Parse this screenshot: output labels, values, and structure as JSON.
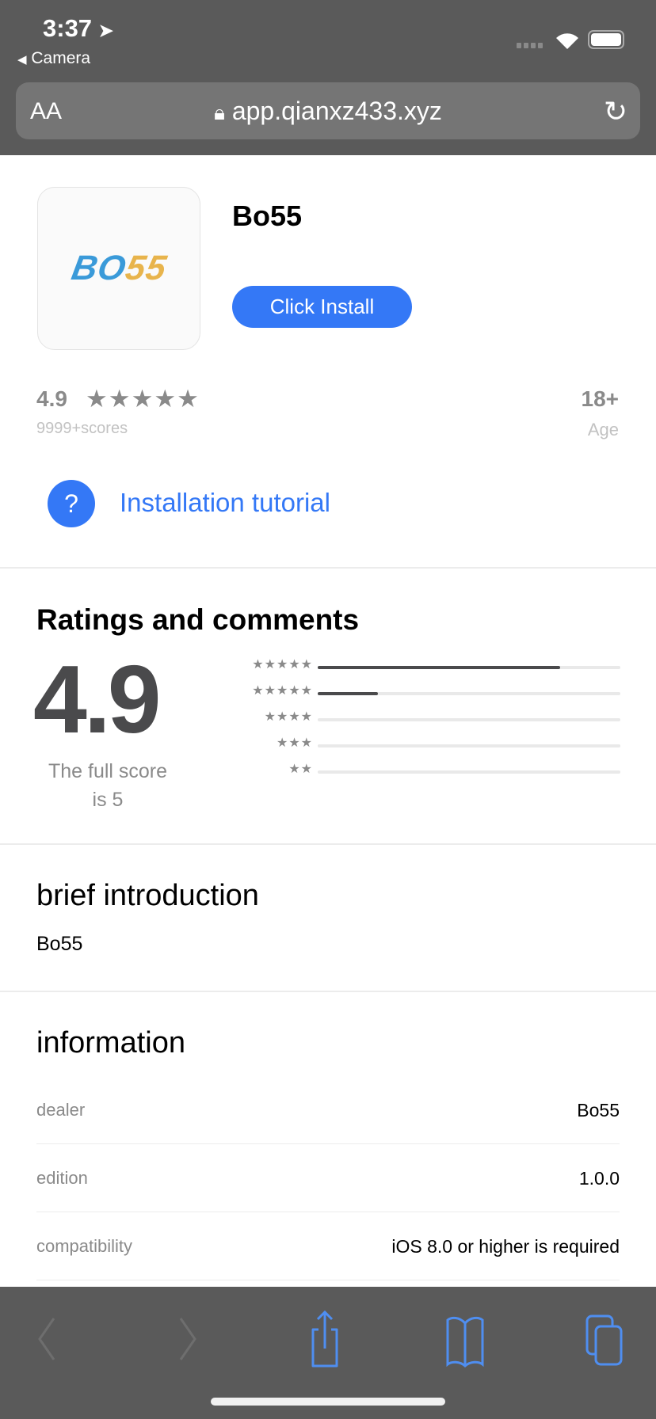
{
  "status_bar": {
    "time": "3:37",
    "back_app": "Camera"
  },
  "browser": {
    "text_size_label": "AA",
    "url": "app.qianxz433.xyz"
  },
  "app": {
    "name": "Bo55",
    "logo_text_blue": "BO",
    "logo_text_gold": "55",
    "install_label": "Click Install",
    "rating": "4.9",
    "stars": "★★★★★",
    "scores": "9999+scores",
    "age": "18+",
    "age_label": "Age",
    "tutorial_label": "Installation tutorial",
    "tutorial_icon": "?"
  },
  "ratings": {
    "title": "Ratings and comments",
    "score": "4.9",
    "full_score_line1": "The full score",
    "full_score_line2": "is 5",
    "rows": [
      {
        "stars": "★★★★★",
        "fraction": 0.8
      },
      {
        "stars": "★★★★★",
        "fraction": 0.2
      },
      {
        "stars": "★★★★",
        "fraction": 0
      },
      {
        "stars": "★★★",
        "fraction": 0
      },
      {
        "stars": "★★",
        "fraction": 0
      }
    ]
  },
  "intro": {
    "title": "brief introduction",
    "text": "Bo55"
  },
  "information": {
    "title": "information",
    "rows": [
      {
        "label": "dealer",
        "value": "Bo55"
      },
      {
        "label": "edition",
        "value": "1.0.0"
      },
      {
        "label": "compatibility",
        "value": "iOS 8.0 or higher is required"
      }
    ]
  },
  "colors": {
    "accent": "#3478f6",
    "chrome": "#5a5a5a",
    "logo_blue": "#3a9ad9",
    "logo_gold": "#e8b44c"
  }
}
